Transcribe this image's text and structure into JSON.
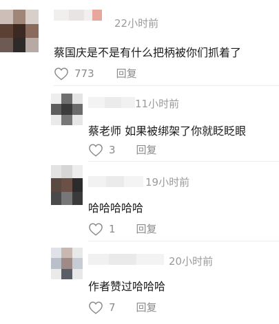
{
  "colors": {
    "time": "#9a9a9a",
    "text": "#1a1a1a",
    "action": "#8a8a8a",
    "divider": "#ececec"
  },
  "icons": {
    "like": "heart-outline-icon"
  },
  "comments": [
    {
      "time": "22小时前",
      "text": "蔡国庆是不是有什么把柄被你们抓着了",
      "likes": "773",
      "reply_label": "回复"
    },
    {
      "time": "11小时前",
      "text": "蔡老师 如果被绑架了你就眨眨眼",
      "likes": "3",
      "reply_label": "回复"
    },
    {
      "time": "19小时前",
      "text": "哈哈哈哈哈",
      "likes": "1",
      "reply_label": "回复"
    },
    {
      "time": "20小时前",
      "text": "作者赞过哈哈哈",
      "likes": "7",
      "reply_label": "回复"
    }
  ]
}
